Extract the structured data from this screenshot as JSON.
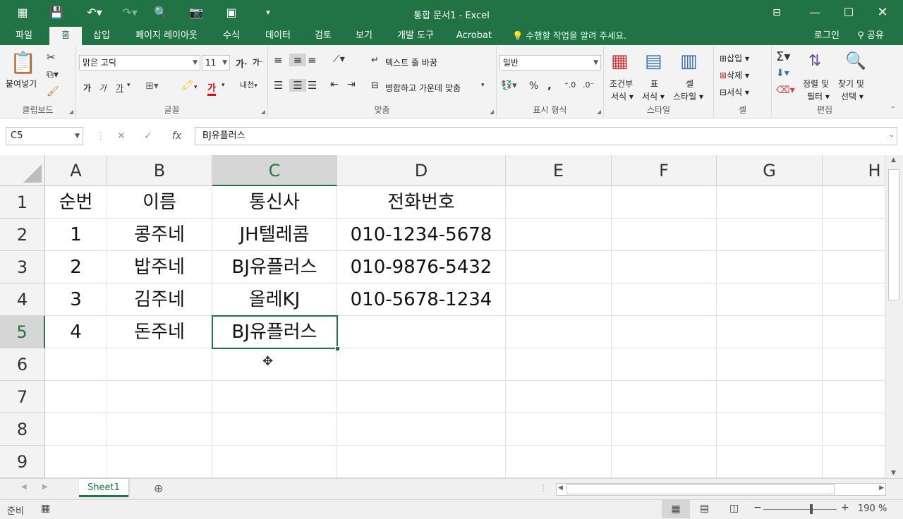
{
  "window": {
    "title": "통합 문서1 - Excel"
  },
  "quick_access": {
    "save_icon": "save-icon",
    "undo_icon": "undo-icon",
    "redo_icon": "redo-icon"
  },
  "tabs": [
    {
      "label": "파일"
    },
    {
      "label": "홈"
    },
    {
      "label": "삽입"
    },
    {
      "label": "페이지 레이아웃"
    },
    {
      "label": "수식"
    },
    {
      "label": "데이터"
    },
    {
      "label": "검토"
    },
    {
      "label": "보기"
    },
    {
      "label": "개발 도구"
    },
    {
      "label": "Acrobat"
    }
  ],
  "tell_me": "수행할 작업을 알려 주세요.",
  "account": {
    "login": "로그인",
    "share": "공유"
  },
  "ribbon": {
    "clipboard": {
      "paste": "붙여넣기",
      "label": "클립보드"
    },
    "font": {
      "name": "맑은 고딕",
      "size": "11",
      "label": "글꼴",
      "bold": "가",
      "italic": "가",
      "underline": "가",
      "grow": "가",
      "shrink": "가",
      "color_char": "가",
      "phonetic": "내천"
    },
    "align": {
      "label": "맞춤",
      "wrap": "텍스트 줄 바꿈",
      "merge": "병합하고 가운데 맞춤"
    },
    "number": {
      "format": "일반",
      "label": "표시 형식",
      "percent": "%",
      "comma": ","
    },
    "styles": {
      "cond": "조건부",
      "cond2": "서식",
      "table": "표",
      "table2": "서식",
      "cell": "셀",
      "cell2": "스타일",
      "label": "스타일"
    },
    "cells": {
      "insert": "삽입",
      "delete": "삭제",
      "format": "서식",
      "label": "셀"
    },
    "edit": {
      "sort": "정렬 및",
      "sort2": "필터",
      "find": "찾기 및",
      "find2": "선택",
      "label": "편집"
    }
  },
  "formula_bar": {
    "name_box": "C5",
    "fx": "fx",
    "content": "BJ유플러스"
  },
  "columns": [
    "A",
    "B",
    "C",
    "D",
    "E",
    "F",
    "G",
    "H"
  ],
  "rows": [
    "1",
    "2",
    "3",
    "4",
    "5",
    "6",
    "7",
    "8",
    "9"
  ],
  "cells": [
    [
      "순번",
      "이름",
      "통신사",
      "전화번호"
    ],
    [
      "1",
      "콩주네",
      "JH텔레콤",
      "010-1234-5678"
    ],
    [
      "2",
      "밥주네",
      "BJ유플러스",
      "010-9876-5432"
    ],
    [
      "3",
      "김주네",
      "올레KJ",
      "010-5678-1234"
    ],
    [
      "4",
      "돈주네",
      "BJ유플러스",
      ""
    ]
  ],
  "sheets": [
    {
      "name": "Sheet1"
    }
  ],
  "status": {
    "mode": "준비",
    "zoom": "190 %"
  }
}
